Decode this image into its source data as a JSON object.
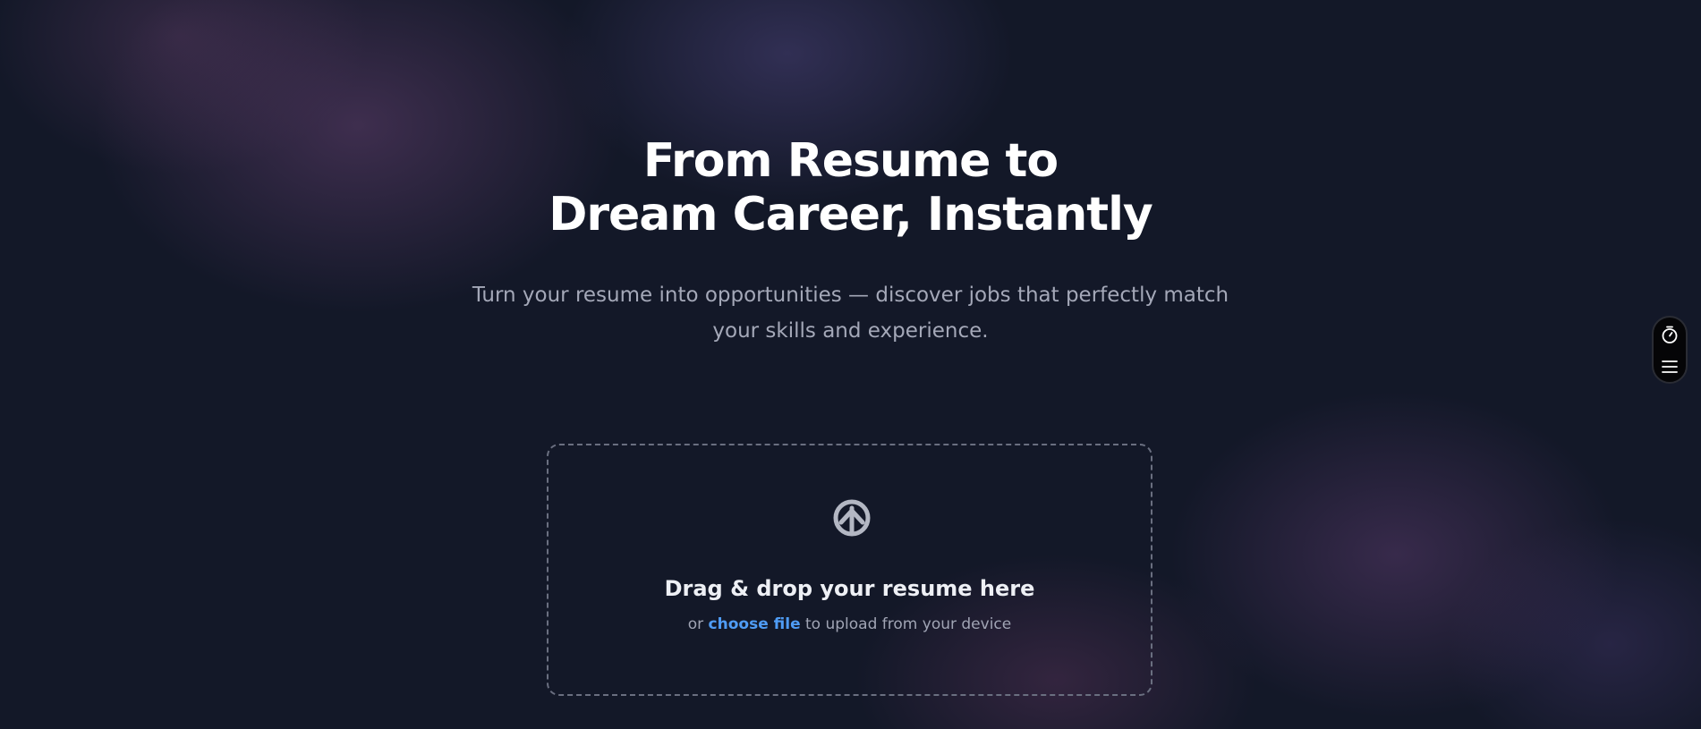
{
  "hero": {
    "title_line1": "From Resume to",
    "title_line2": "Dream Career, Instantly",
    "subtitle": "Turn your resume into opportunities — discover jobs that perfectly match your skills and experience."
  },
  "upload": {
    "icon": "upload-arrow-icon",
    "title": "Drag & drop your resume here",
    "prefix": "or",
    "link_label": "choose file",
    "suffix": "to upload from your device"
  },
  "side_widget": {
    "icons": [
      "timer-icon",
      "menu-icon"
    ]
  },
  "colors": {
    "background": "#131828",
    "link": "#4f9cf5",
    "title": "#ffffff",
    "subtitle": "#a4a8b8"
  }
}
